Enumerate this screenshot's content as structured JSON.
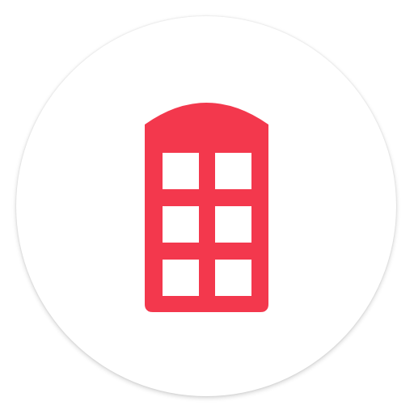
{
  "app_icon": {
    "icon": "phone-booth-icon",
    "background_color": "#ffffff",
    "accent_color": "#f3384d",
    "window_color": "#ffffff",
    "window_rows": 3,
    "window_columns": 2
  }
}
